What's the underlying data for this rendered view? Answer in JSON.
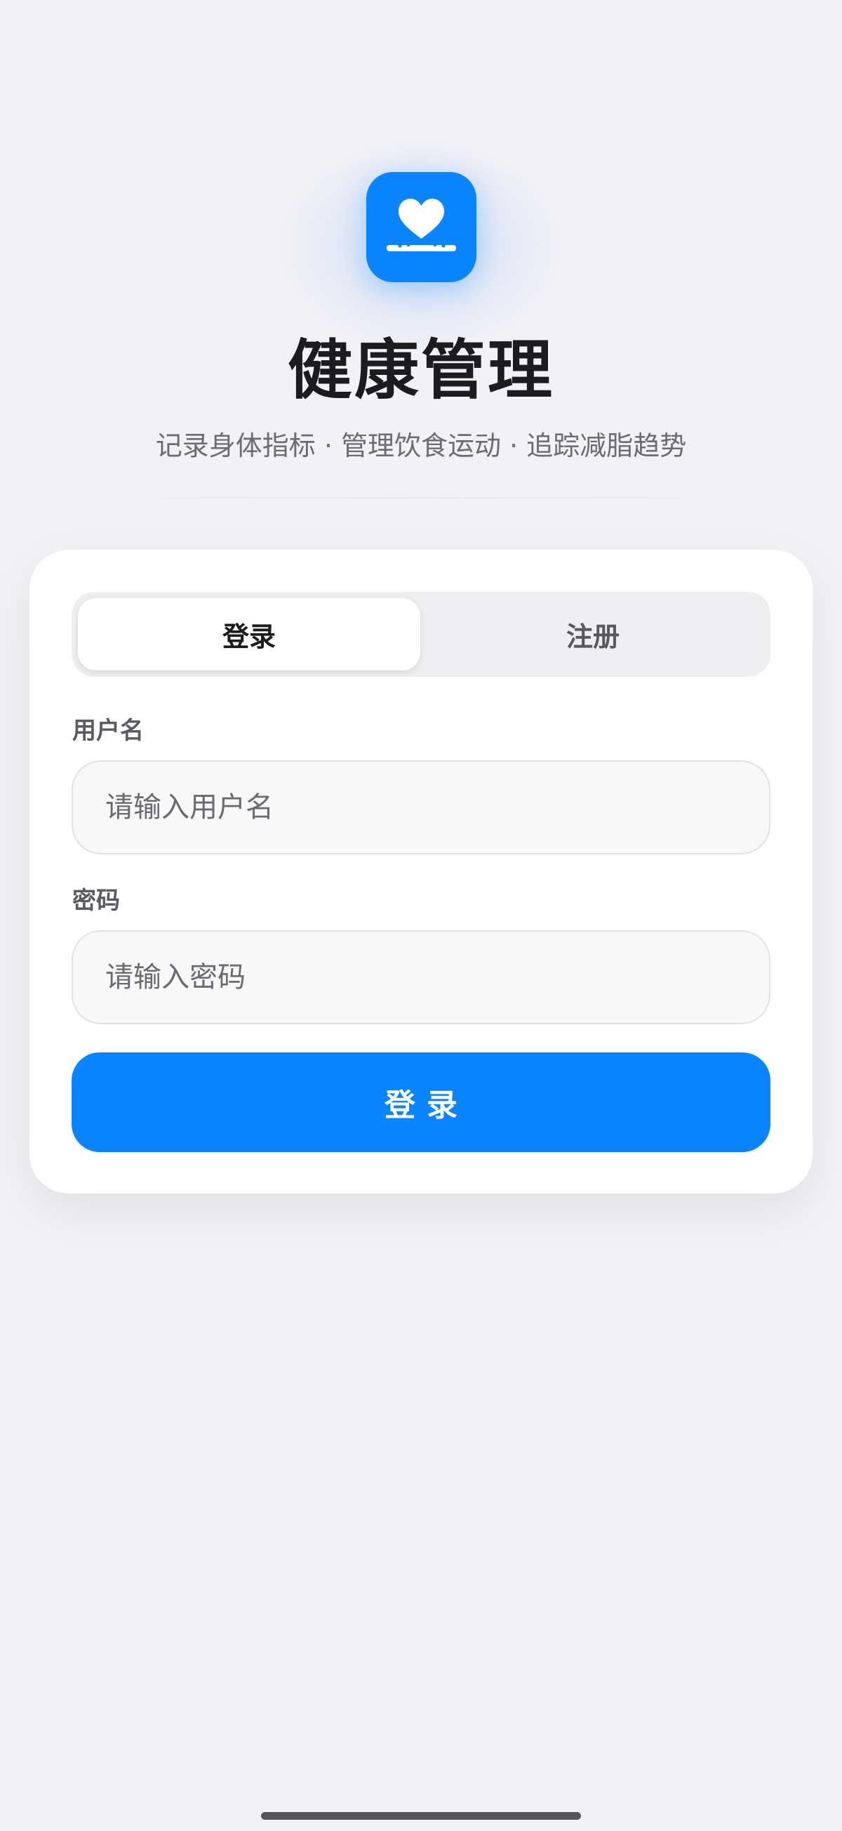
{
  "app": {
    "logo_icon": "heart-on-scale-icon",
    "title": "健康管理",
    "subtitle": "记录身体指标 · 管理饮食运动 · 追踪减脂趋势"
  },
  "auth": {
    "tabs": [
      {
        "label": "登录",
        "active": true
      },
      {
        "label": "注册",
        "active": false
      }
    ],
    "username": {
      "label": "用户名",
      "placeholder": "请输入用户名",
      "value": ""
    },
    "password": {
      "label": "密码",
      "placeholder": "请输入密码",
      "value": ""
    },
    "submit_label": "登录"
  },
  "colors": {
    "accent": "#0a84ff",
    "background": "#f1f1f6",
    "card": "#ffffff",
    "title_text": "#1c1c1e",
    "muted_text": "#6c6c72"
  }
}
